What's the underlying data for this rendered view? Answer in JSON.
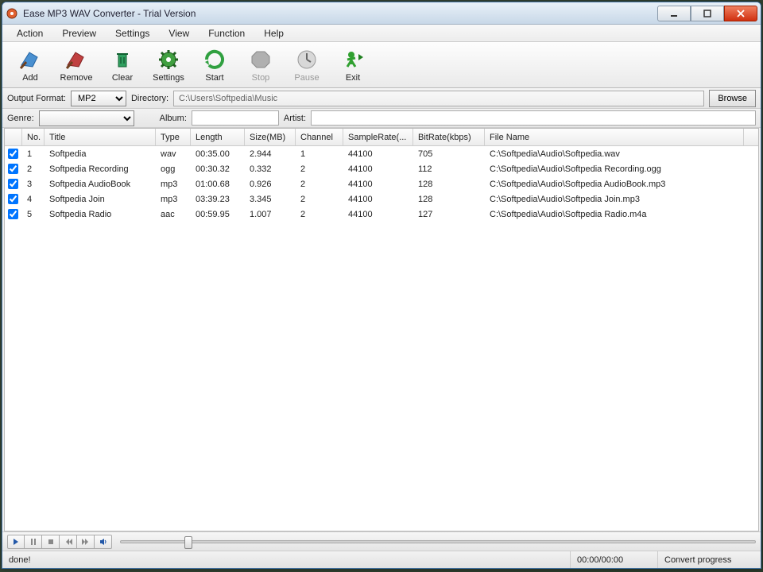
{
  "window": {
    "title": "Ease MP3 WAV Converter - Trial Version"
  },
  "menu": [
    "Action",
    "Preview",
    "Settings",
    "View",
    "Function",
    "Help"
  ],
  "toolbar": {
    "add": "Add",
    "remove": "Remove",
    "clear": "Clear",
    "settings": "Settings",
    "start": "Start",
    "stop": "Stop",
    "pause": "Pause",
    "exit": "Exit"
  },
  "output": {
    "format_label": "Output Format:",
    "format_value": "MP2",
    "directory_label": "Directory:",
    "directory_value": "C:\\Users\\Softpedia\\Music",
    "browse": "Browse"
  },
  "tags": {
    "genre_label": "Genre:",
    "album_label": "Album:",
    "artist_label": "Artist:"
  },
  "columns": {
    "no": "No.",
    "title": "Title",
    "type": "Type",
    "length": "Length",
    "size": "Size(MB)",
    "channel": "Channel",
    "sample": "SampleRate(...",
    "bitrate": "BitRate(kbps)",
    "file": "File Name"
  },
  "rows": [
    {
      "no": "1",
      "title": "Softpedia",
      "type": "wav",
      "length": "00:35.00",
      "size": "2.944",
      "channel": "1",
      "sample": "44100",
      "bitrate": "705",
      "file": "C:\\Softpedia\\Audio\\Softpedia.wav"
    },
    {
      "no": "2",
      "title": "Softpedia Recording",
      "type": "ogg",
      "length": "00:30.32",
      "size": "0.332",
      "channel": "2",
      "sample": "44100",
      "bitrate": "112",
      "file": "C:\\Softpedia\\Audio\\Softpedia Recording.ogg"
    },
    {
      "no": "3",
      "title": "Softpedia AudioBook",
      "type": "mp3",
      "length": "01:00.68",
      "size": "0.926",
      "channel": "2",
      "sample": "44100",
      "bitrate": "128",
      "file": "C:\\Softpedia\\Audio\\Softpedia AudioBook.mp3"
    },
    {
      "no": "4",
      "title": "Softpedia Join",
      "type": "mp3",
      "length": "03:39.23",
      "size": "3.345",
      "channel": "2",
      "sample": "44100",
      "bitrate": "128",
      "file": "C:\\Softpedia\\Audio\\Softpedia Join.mp3"
    },
    {
      "no": "5",
      "title": "Softpedia Radio",
      "type": "aac",
      "length": "00:59.95",
      "size": "1.007",
      "channel": "2",
      "sample": "44100",
      "bitrate": "127",
      "file": "C:\\Softpedia\\Audio\\Softpedia Radio.m4a"
    }
  ],
  "status": {
    "left": "done!",
    "time": "00:00/00:00",
    "progress": "Convert progress"
  }
}
